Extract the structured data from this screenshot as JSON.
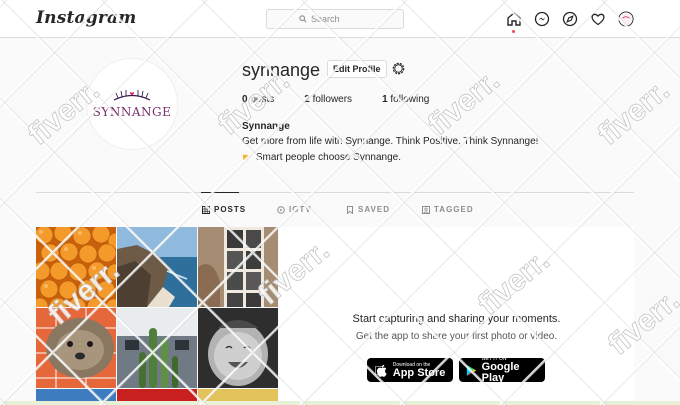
{
  "header": {
    "logo": "Instagram",
    "search_placeholder": "Search"
  },
  "profile": {
    "username": "synnange",
    "edit_label": "Edit Profile",
    "avatar_text": "SYNNANGE",
    "stats": {
      "posts_count": "0",
      "posts_label": "posts",
      "followers_count": "2",
      "followers_label": "followers",
      "following_count": "1",
      "following_label": "following"
    },
    "full_name": "Synnange",
    "bio_line1": "Get more from life with Synnange. Think Positive, Think Synnange!",
    "bio_line2": "Smart people choose Synnange."
  },
  "tabs": [
    {
      "label": "POSTS",
      "icon": "grid-icon",
      "active": true
    },
    {
      "label": "IGTV",
      "icon": "igtv-icon",
      "active": false
    },
    {
      "label": "SAVED",
      "icon": "bookmark-icon",
      "active": false
    },
    {
      "label": "TAGGED",
      "icon": "tag-icon",
      "active": false
    }
  ],
  "promo": {
    "title": "Start capturing and sharing your moments.",
    "subtitle": "Get the app to share your first photo or video.",
    "appstore_small": "Download on the",
    "appstore_big": "App Store",
    "googleplay_small": "GET IT ON",
    "googleplay_big": "Google Play"
  },
  "watermark": "fiverr.",
  "colors": {
    "accent_red": "#ed4956",
    "avatar_text": "#7a2f6b",
    "text": "#262626",
    "muted": "#8e8e8e"
  }
}
